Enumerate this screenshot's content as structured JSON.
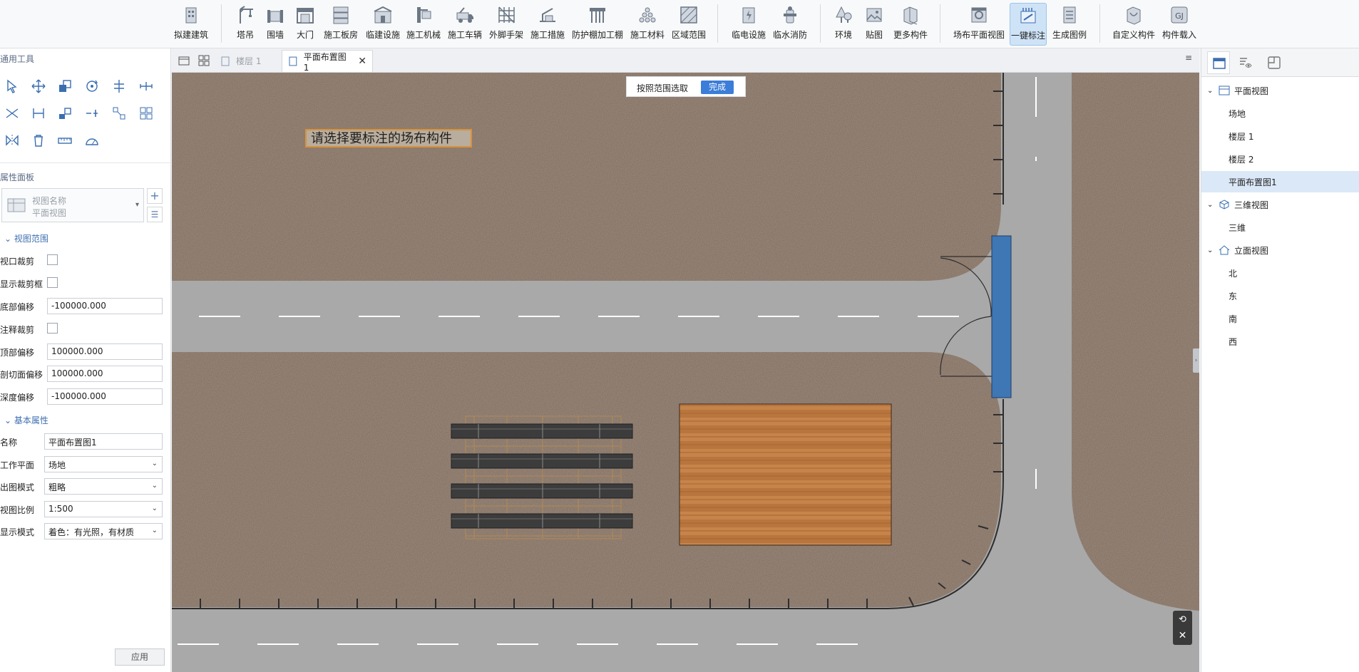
{
  "ribbon": {
    "buttons": [
      {
        "id": "draft",
        "label": "拟建建筑",
        "icon": "building-icon"
      },
      {
        "id": "crane",
        "label": "塔吊",
        "icon": "tower-crane-icon"
      },
      {
        "id": "wall",
        "label": "围墙",
        "icon": "fence-wall-icon"
      },
      {
        "id": "gate",
        "label": "大门",
        "icon": "gate-icon"
      },
      {
        "id": "board",
        "label": "施工板房",
        "icon": "site-office-icon"
      },
      {
        "id": "temp",
        "label": "临建设施",
        "icon": "temporary-facility-icon"
      },
      {
        "id": "machine",
        "label": "施工机械",
        "icon": "machinery-icon"
      },
      {
        "id": "vehicle",
        "label": "施工车辆",
        "icon": "vehicle-icon"
      },
      {
        "id": "scaffold",
        "label": "外脚手架",
        "icon": "scaffold-icon"
      },
      {
        "id": "measure",
        "label": "施工措施",
        "icon": "measure-icon"
      },
      {
        "id": "shed",
        "label": "防护棚加工棚",
        "icon": "shed-icon"
      },
      {
        "id": "material",
        "label": "施工材料",
        "icon": "material-icon"
      },
      {
        "id": "area",
        "label": "区域范围",
        "icon": "area-icon"
      },
      {
        "id": "power",
        "label": "临电设施",
        "icon": "power-icon"
      },
      {
        "id": "water",
        "label": "临水消防",
        "icon": "hydrant-icon"
      },
      {
        "id": "env",
        "label": "环境",
        "icon": "tree-icon"
      },
      {
        "id": "paste",
        "label": "贴图",
        "icon": "picture-icon"
      },
      {
        "id": "more",
        "label": "更多构件",
        "icon": "more-components-icon"
      },
      {
        "id": "planview",
        "label": "场布平面视图",
        "icon": "plan-view-icon"
      },
      {
        "id": "annotate",
        "label": "一键标注",
        "icon": "annotate-icon"
      },
      {
        "id": "legend",
        "label": "生成图例",
        "icon": "legend-icon"
      },
      {
        "id": "custom",
        "label": "自定义构件",
        "icon": "custom-component-icon"
      },
      {
        "id": "load",
        "label": "构件载入",
        "icon": "load-component-icon"
      }
    ]
  },
  "left": {
    "tools_title": "通用工具",
    "props_title": "属性面板",
    "view_name_label": "视图名称",
    "view_name_value": "平面视图",
    "groups": {
      "range": "视图范围",
      "basic": "基本属性"
    },
    "range_props": [
      {
        "label": "视口裁剪",
        "type": "checkbox"
      },
      {
        "label": "显示裁剪框",
        "type": "checkbox"
      },
      {
        "label": "底部偏移",
        "type": "input",
        "value": "-100000.000"
      },
      {
        "label": "注释裁剪",
        "type": "checkbox"
      },
      {
        "label": "顶部偏移",
        "type": "input",
        "value": "100000.000"
      },
      {
        "label": "剖切面偏移",
        "type": "input",
        "value": "100000.000"
      },
      {
        "label": "深度偏移",
        "type": "input",
        "value": "-100000.000"
      }
    ],
    "basic_props": [
      {
        "label": "名称",
        "type": "input",
        "value": "平面布置图1"
      },
      {
        "label": "工作平面",
        "type": "select",
        "value": "场地"
      },
      {
        "label": "出图模式",
        "type": "select",
        "value": "粗略"
      },
      {
        "label": "视图比例",
        "type": "select",
        "value": "1:500"
      },
      {
        "label": "显示模式",
        "type": "select",
        "value": "着色：有光照，有材质"
      }
    ],
    "apply_label": "应用"
  },
  "tabs": [
    {
      "label": "楼层 1",
      "active": false
    },
    {
      "label": "平面布置图1",
      "active": true
    }
  ],
  "canvas": {
    "select_hint": "按照范围选取",
    "done_label": "完成",
    "prompt": "请选择要标注的场布构件"
  },
  "right": {
    "tree": [
      {
        "label": "平面视图",
        "level": 0,
        "icon": "plan-view-icon"
      },
      {
        "label": "场地",
        "level": 1
      },
      {
        "label": "楼层 1",
        "level": 1
      },
      {
        "label": "楼层 2",
        "level": 1
      },
      {
        "label": "平面布置图1",
        "level": 1,
        "selected": true
      },
      {
        "label": "三维视图",
        "level": 0,
        "icon": "cube-icon"
      },
      {
        "label": "三维",
        "level": 1
      },
      {
        "label": "立面视图",
        "level": 0,
        "icon": "elevation-icon"
      },
      {
        "label": "北",
        "level": 1
      },
      {
        "label": "东",
        "level": 1
      },
      {
        "label": "南",
        "level": 1
      },
      {
        "label": "西",
        "level": 1
      }
    ]
  },
  "colors": {
    "accent": "#3b7dd8",
    "road": "#a9a9a9",
    "ground": "#7e6a5c",
    "gate": "#3f77b5"
  }
}
